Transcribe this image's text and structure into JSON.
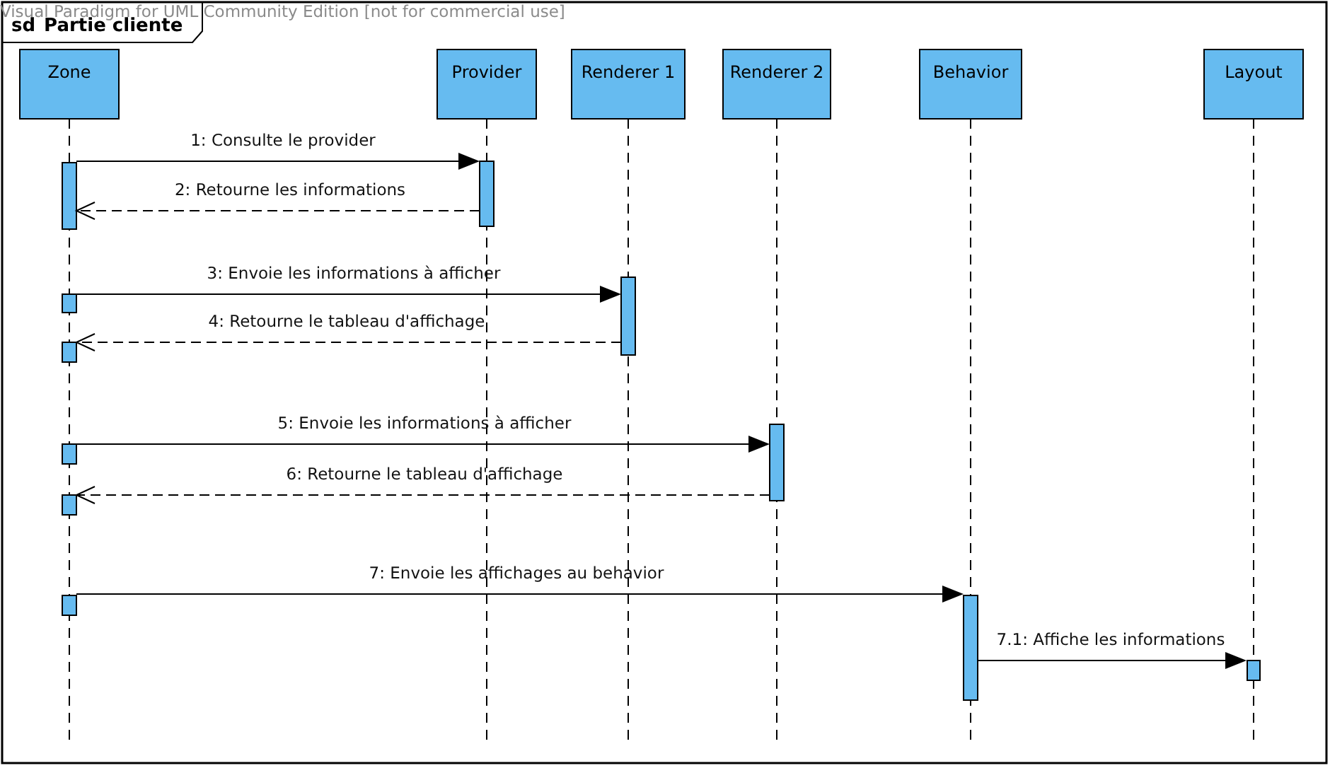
{
  "watermark": "Visual Paradigm for UML Community Edition [not for commercial use]",
  "frame": {
    "keyword": "sd",
    "title": "Partie cliente"
  },
  "lifelines": [
    {
      "name": "Zone"
    },
    {
      "name": "Provider"
    },
    {
      "name": "Renderer 1"
    },
    {
      "name": "Renderer 2"
    },
    {
      "name": "Behavior"
    },
    {
      "name": "Layout"
    }
  ],
  "messages": [
    {
      "label": "1: Consulte le provider",
      "kind": "call"
    },
    {
      "label": "2: Retourne les informations",
      "kind": "return"
    },
    {
      "label": "3: Envoie les informations à afficher",
      "kind": "call"
    },
    {
      "label": "4: Retourne le tableau d'affichage",
      "kind": "return"
    },
    {
      "label": "5: Envoie les informations à afficher",
      "kind": "call"
    },
    {
      "label": "6: Retourne le tableau d'affichage",
      "kind": "return"
    },
    {
      "label": "7: Envoie les affichages au behavior",
      "kind": "call"
    },
    {
      "label": "7.1: Affiche les informations",
      "kind": "call"
    }
  ]
}
